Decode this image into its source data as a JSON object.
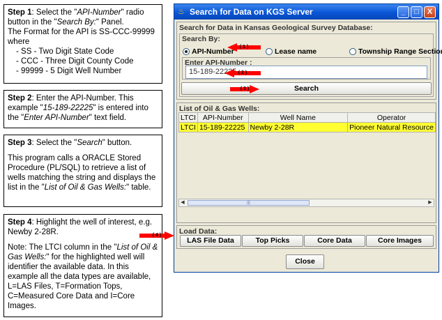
{
  "steps": {
    "s1": {
      "heading": "Step 1",
      "t1": ": Select the \"",
      "i1": "API-Number",
      "t2": "\" radio button in the \"",
      "i2": "Search By:",
      "t3": "\" Panel.",
      "line2": "The Format for the API is SS-CCC-99999 where",
      "items": [
        "SS -  Two Digit State Code",
        "CCC - Three Digit County Code",
        "99999 - 5 Digit Well Number"
      ]
    },
    "s2": {
      "heading": "Step 2",
      "t1": ": Enter the API-Number. This example \"",
      "i1": "15-189-22225",
      "t2": "\" is entered into the \"",
      "i2": "Enter API-Number",
      "t3": "\" text field."
    },
    "s3": {
      "heading": "Step 3",
      "t1": ": Select the \"",
      "i1": "Search",
      "t2": "\" button.",
      "p2a": "This program calls a ORACLE Stored Procedure (PL/SQL) to retrieve a list of wells matching the string and displays the list in the \"",
      "p2i": "List of Oil & Gas Wells:",
      "p2b": "\" table."
    },
    "s4": {
      "heading": "Step 4",
      "t1": ": Highlight the well of interest, e.g. Newby 2-28R.",
      "p2a": "Note: The LTCI column in the \"",
      "p2i": "List of Oil & Gas Wells:",
      "p2b": "\" for the highlighted well will identifier the available data. In this example all the data types are available, L=LAS Files, T=Formation Tops, C=Measured Core Data and I=Core Images."
    }
  },
  "window": {
    "title": "Search for Data on KGS Server",
    "min_label": "_",
    "max_label": "□",
    "close_label": "X",
    "main_panel_label": "Search for Data in Kansas Geological Survey Database:",
    "search_by_label": "Search By:",
    "radio_api": "API-Number",
    "radio_lease": "Lease name",
    "radio_township": "Township Range Section",
    "api_field_label": "Enter API-Number :",
    "api_value": "15-189-22225",
    "search_button": "Search",
    "list_label": "List of Oil & Gas Wells:",
    "columns": [
      "LTCI",
      "API-Number",
      "Well Name",
      "Operator"
    ],
    "row": {
      "ltci": "LTCI",
      "api": "15-189-22225",
      "name": "Newby 2-28R",
      "operator": "Pioneer Natural Resource"
    },
    "load_label": "Load Data:",
    "btn_las": "LAS File Data",
    "btn_tops": "Top Picks",
    "btn_core": "Core Data",
    "btn_images": "Core Images",
    "btn_close": "Close",
    "scroll_left": "◀",
    "scroll_right": "▶",
    "scroll_thumb": "|||"
  },
  "arrows": {
    "a1": "( 1 )",
    "a2": "( 2 )",
    "a3": "( 3 )",
    "a4": "( 4 )"
  },
  "colors": {
    "arrow_red": "#ff0000",
    "highlight_yellow": "#ffff33",
    "title_blue": "#0a55d6"
  }
}
